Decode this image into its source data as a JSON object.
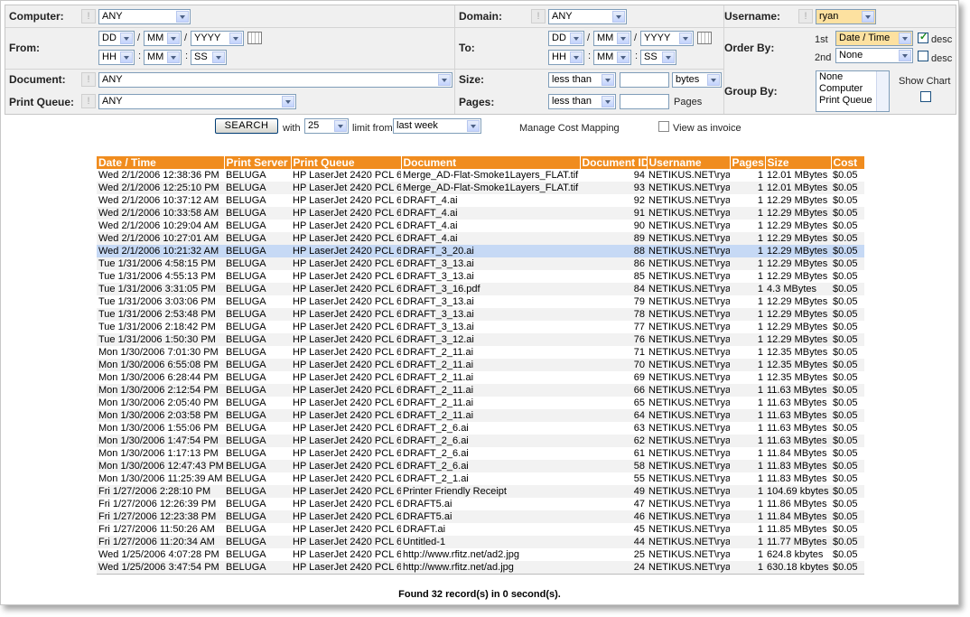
{
  "filters": {
    "computer": {
      "label": "Computer:",
      "value": "ANY"
    },
    "domain": {
      "label": "Domain:",
      "value": "ANY"
    },
    "username": {
      "label": "Username:",
      "value": "ryan"
    },
    "from": {
      "label": "From:",
      "dd": "DD",
      "mm": "MM",
      "yyyy": "YYYY",
      "hh": "HH",
      "min": "MM",
      "ss": "SS",
      "sep_date": "/",
      "sep_time": ":"
    },
    "to": {
      "label": "To:",
      "dd": "DD",
      "mm": "MM",
      "yyyy": "YYYY",
      "hh": "HH",
      "min": "MM",
      "ss": "SS",
      "sep_date": "/",
      "sep_time": ":"
    },
    "order_by": {
      "label": "Order By:",
      "first_label": "1st",
      "first_value": "Date / Time",
      "second_label": "2nd",
      "second_value": "None",
      "desc_label": "desc",
      "first_desc": true,
      "second_desc": false
    },
    "document": {
      "label": "Document:",
      "value": "ANY"
    },
    "print_queue": {
      "label": "Print Queue:",
      "value": "ANY"
    },
    "size": {
      "label": "Size:",
      "comparator": "less than",
      "value": "",
      "unit": "bytes"
    },
    "pages": {
      "label": "Pages:",
      "comparator": "less than",
      "value": "",
      "unit": "Pages"
    },
    "group_by": {
      "label": "Group By:",
      "options": [
        "None",
        "Computer",
        "Print Queue"
      ]
    },
    "show_chart": {
      "label": "Show Chart",
      "checked": false
    }
  },
  "searchbar": {
    "search_label": "SEARCH",
    "with_label": "with",
    "limit_value": "25",
    "limit_from_label": "limit from",
    "range_value": "last week",
    "manage_cost_label": "Manage Cost Mapping",
    "invoice_label": "View as invoice"
  },
  "table": {
    "columns": [
      "Date / Time",
      "Print Server",
      "Print Queue",
      "Document",
      "Document ID",
      "Username",
      "Pages",
      "Size",
      "Cost"
    ],
    "rows": [
      [
        "Wed 2/1/2006 12:38:36 PM",
        "BELUGA",
        "HP LaserJet 2420 PCL 6",
        "Merge_AD-Flat-Smoke1Layers_FLAT.tif",
        "94",
        "NETIKUS.NET\\ryan",
        "1",
        "12.01 MBytes",
        "$0.05"
      ],
      [
        "Wed 2/1/2006 12:25:10 PM",
        "BELUGA",
        "HP LaserJet 2420 PCL 6",
        "Merge_AD-Flat-Smoke1Layers_FLAT.tif",
        "93",
        "NETIKUS.NET\\ryan",
        "1",
        "12.01 MBytes",
        "$0.05"
      ],
      [
        "Wed 2/1/2006 10:37:12 AM",
        "BELUGA",
        "HP LaserJet 2420 PCL 6",
        "DRAFT_4.ai",
        "92",
        "NETIKUS.NET\\ryan",
        "1",
        "12.29 MBytes",
        "$0.05"
      ],
      [
        "Wed 2/1/2006 10:33:58 AM",
        "BELUGA",
        "HP LaserJet 2420 PCL 6",
        "DRAFT_4.ai",
        "91",
        "NETIKUS.NET\\ryan",
        "1",
        "12.29 MBytes",
        "$0.05"
      ],
      [
        "Wed 2/1/2006 10:29:04 AM",
        "BELUGA",
        "HP LaserJet 2420 PCL 6",
        "DRAFT_4.ai",
        "90",
        "NETIKUS.NET\\ryan",
        "1",
        "12.29 MBytes",
        "$0.05"
      ],
      [
        "Wed 2/1/2006 10:27:01 AM",
        "BELUGA",
        "HP LaserJet 2420 PCL 6",
        "DRAFT_4.ai",
        "89",
        "NETIKUS.NET\\ryan",
        "1",
        "12.29 MBytes",
        "$0.05"
      ],
      [
        "Wed 2/1/2006 10:21:32 AM",
        "BELUGA",
        "HP LaserJet 2420 PCL 6",
        "DRAFT_3_20.ai",
        "88",
        "NETIKUS.NET\\ryan",
        "1",
        "12.29 MBytes",
        "$0.05"
      ],
      [
        "Tue 1/31/2006 4:58:15 PM",
        "BELUGA",
        "HP LaserJet 2420 PCL 6",
        "DRAFT_3_13.ai",
        "86",
        "NETIKUS.NET\\ryan",
        "1",
        "12.29 MBytes",
        "$0.05"
      ],
      [
        "Tue 1/31/2006 4:55:13 PM",
        "BELUGA",
        "HP LaserJet 2420 PCL 6",
        "DRAFT_3_13.ai",
        "85",
        "NETIKUS.NET\\ryan",
        "1",
        "12.29 MBytes",
        "$0.05"
      ],
      [
        "Tue 1/31/2006 3:31:05 PM",
        "BELUGA",
        "HP LaserJet 2420 PCL 6",
        "DRAFT_3_16.pdf",
        "84",
        "NETIKUS.NET\\ryan",
        "1",
        "4.3 MBytes",
        "$0.05"
      ],
      [
        "Tue 1/31/2006 3:03:06 PM",
        "BELUGA",
        "HP LaserJet 2420 PCL 6",
        "DRAFT_3_13.ai",
        "79",
        "NETIKUS.NET\\ryan",
        "1",
        "12.29 MBytes",
        "$0.05"
      ],
      [
        "Tue 1/31/2006 2:53:48 PM",
        "BELUGA",
        "HP LaserJet 2420 PCL 6",
        "DRAFT_3_13.ai",
        "78",
        "NETIKUS.NET\\ryan",
        "1",
        "12.29 MBytes",
        "$0.05"
      ],
      [
        "Tue 1/31/2006 2:18:42 PM",
        "BELUGA",
        "HP LaserJet 2420 PCL 6",
        "DRAFT_3_13.ai",
        "77",
        "NETIKUS.NET\\ryan",
        "1",
        "12.29 MBytes",
        "$0.05"
      ],
      [
        "Tue 1/31/2006 1:50:30 PM",
        "BELUGA",
        "HP LaserJet 2420 PCL 6",
        "DRAFT_3_12.ai",
        "76",
        "NETIKUS.NET\\ryan",
        "1",
        "12.29 MBytes",
        "$0.05"
      ],
      [
        "Mon 1/30/2006 7:01:30 PM",
        "BELUGA",
        "HP LaserJet 2420 PCL 6",
        "DRAFT_2_11.ai",
        "71",
        "NETIKUS.NET\\ryan",
        "1",
        "12.35 MBytes",
        "$0.05"
      ],
      [
        "Mon 1/30/2006 6:55:08 PM",
        "BELUGA",
        "HP LaserJet 2420 PCL 6",
        "DRAFT_2_11.ai",
        "70",
        "NETIKUS.NET\\ryan",
        "1",
        "12.35 MBytes",
        "$0.05"
      ],
      [
        "Mon 1/30/2006 6:28:44 PM",
        "BELUGA",
        "HP LaserJet 2420 PCL 6",
        "DRAFT_2_11.ai",
        "69",
        "NETIKUS.NET\\ryan",
        "1",
        "12.35 MBytes",
        "$0.05"
      ],
      [
        "Mon 1/30/2006 2:12:54 PM",
        "BELUGA",
        "HP LaserJet 2420 PCL 6",
        "DRAFT_2_11.ai",
        "66",
        "NETIKUS.NET\\ryan",
        "1",
        "11.63 MBytes",
        "$0.05"
      ],
      [
        "Mon 1/30/2006 2:05:40 PM",
        "BELUGA",
        "HP LaserJet 2420 PCL 6",
        "DRAFT_2_11.ai",
        "65",
        "NETIKUS.NET\\ryan",
        "1",
        "11.63 MBytes",
        "$0.05"
      ],
      [
        "Mon 1/30/2006 2:03:58 PM",
        "BELUGA",
        "HP LaserJet 2420 PCL 6",
        "DRAFT_2_11.ai",
        "64",
        "NETIKUS.NET\\ryan",
        "1",
        "11.63 MBytes",
        "$0.05"
      ],
      [
        "Mon 1/30/2006 1:55:06 PM",
        "BELUGA",
        "HP LaserJet 2420 PCL 6",
        "DRAFT_2_6.ai",
        "63",
        "NETIKUS.NET\\ryan",
        "1",
        "11.63 MBytes",
        "$0.05"
      ],
      [
        "Mon 1/30/2006 1:47:54 PM",
        "BELUGA",
        "HP LaserJet 2420 PCL 6",
        "DRAFT_2_6.ai",
        "62",
        "NETIKUS.NET\\ryan",
        "1",
        "11.63 MBytes",
        "$0.05"
      ],
      [
        "Mon 1/30/2006 1:17:13 PM",
        "BELUGA",
        "HP LaserJet 2420 PCL 6",
        "DRAFT_2_6.ai",
        "61",
        "NETIKUS.NET\\ryan",
        "1",
        "11.84 MBytes",
        "$0.05"
      ],
      [
        "Mon 1/30/2006 12:47:43 PM",
        "BELUGA",
        "HP LaserJet 2420 PCL 6",
        "DRAFT_2_6.ai",
        "58",
        "NETIKUS.NET\\ryan",
        "1",
        "11.83 MBytes",
        "$0.05"
      ],
      [
        "Mon 1/30/2006 11:25:39 AM",
        "BELUGA",
        "HP LaserJet 2420 PCL 6",
        "DRAFT_2_1.ai",
        "55",
        "NETIKUS.NET\\ryan",
        "1",
        "11.83 MBytes",
        "$0.05"
      ],
      [
        "Fri 1/27/2006 2:28:10 PM",
        "BELUGA",
        "HP LaserJet 2420 PCL 6",
        "Printer Friendly Receipt",
        "49",
        "NETIKUS.NET\\ryan",
        "1",
        "104.69 kbytes",
        "$0.05"
      ],
      [
        "Fri 1/27/2006 12:26:39 PM",
        "BELUGA",
        "HP LaserJet 2420 PCL 6",
        "DRAFT5.ai",
        "47",
        "NETIKUS.NET\\ryan",
        "1",
        "11.86 MBytes",
        "$0.05"
      ],
      [
        "Fri 1/27/2006 12:23:38 PM",
        "BELUGA",
        "HP LaserJet 2420 PCL 6",
        "DRAFT5.ai",
        "46",
        "NETIKUS.NET\\ryan",
        "1",
        "11.84 MBytes",
        "$0.05"
      ],
      [
        "Fri 1/27/2006 11:50:26 AM",
        "BELUGA",
        "HP LaserJet 2420 PCL 6",
        "DRAFT.ai",
        "45",
        "NETIKUS.NET\\ryan",
        "1",
        "11.85 MBytes",
        "$0.05"
      ],
      [
        "Fri 1/27/2006 11:20:34 AM",
        "BELUGA",
        "HP LaserJet 2420 PCL 6",
        "Untitled-1",
        "44",
        "NETIKUS.NET\\ryan",
        "1",
        "11.77 MBytes",
        "$0.05"
      ],
      [
        "Wed 1/25/2006 4:07:28 PM",
        "BELUGA",
        "HP LaserJet 2420 PCL 6",
        "http://www.rfitz.net/ad2.jpg",
        "25",
        "NETIKUS.NET\\ryan",
        "1",
        "624.8 kbytes",
        "$0.05"
      ],
      [
        "Wed 1/25/2006 3:47:54 PM",
        "BELUGA",
        "HP LaserJet 2420 PCL 6",
        "http://www.rfitz.net/ad.jpg",
        "24",
        "NETIKUS.NET\\ryan",
        "1",
        "630.18 kbytes",
        "$0.05"
      ]
    ],
    "selected_row": 6
  },
  "footer": {
    "text": "Found 32 record(s) in 0 second(s)."
  },
  "colors": {
    "header_bg": "#f08c1e",
    "selected_row": "#c6d9f5",
    "highlight_select": "#fde1a0"
  }
}
